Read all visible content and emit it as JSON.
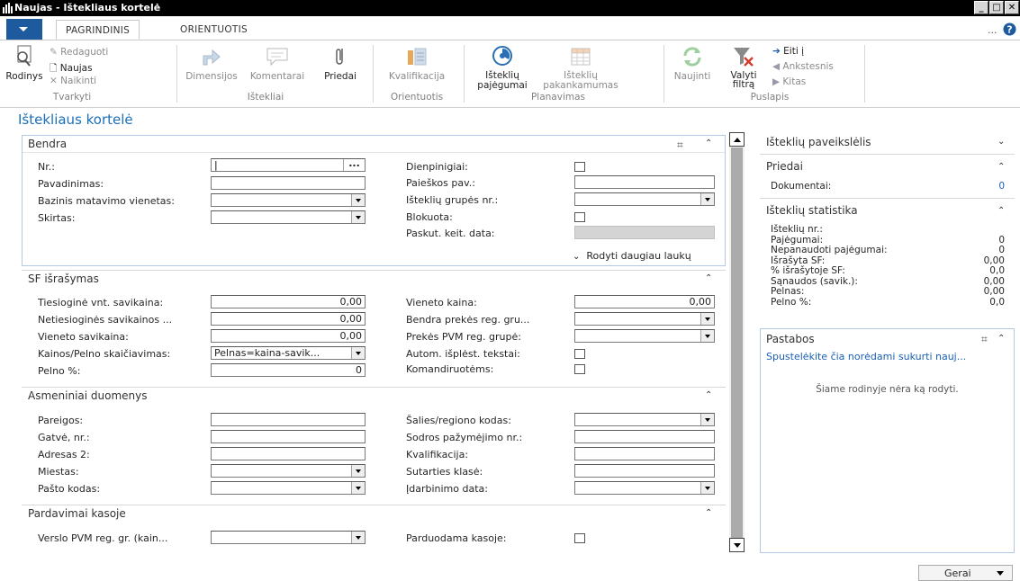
{
  "window": {
    "title": "Naujas - Ištekliaus kortelė"
  },
  "ribbon_tabs": [
    "PAGRINDINIS",
    "ORIENTUOTIS"
  ],
  "ribbon": {
    "tvarkyti": {
      "label": "Tvarkyti",
      "rodinys": "Rodinys",
      "redaguoti": "Redaguoti",
      "naujas": "Naujas",
      "naikinti": "Naikinti"
    },
    "istekliai": {
      "label": "Ištekliai",
      "dimensijos": "Dimensijos",
      "komentarai": "Komentarai",
      "priedai": "Priedai"
    },
    "orientuotis": {
      "label": "Orientuotis",
      "kvalifikacija": "Kvalifikacija"
    },
    "planavimas": {
      "label": "Planavimas",
      "pajegumai_1": "Išteklių",
      "pajegumai_2": "pajėgumai",
      "pakankamumas_1": "Išteklių",
      "pakankamumas_2": "pakankamumas"
    },
    "puslapis": {
      "label": "Puslapis",
      "naujinti": "Naujinti",
      "valyti_1": "Valyti",
      "valyti_2": "filtrą",
      "eiti": "Eiti į",
      "ankstesnis": "Ankstesnis",
      "kitas": "Kitas"
    },
    "more": "..."
  },
  "page_title": "Ištekliaus kortelė",
  "bendra": {
    "title": "Bendra",
    "left": {
      "nr": "Nr.:",
      "pavadinimas": "Pavadinimas:",
      "bazinis": "Bazinis matavimo vienetas:",
      "skirtas": "Skirtas:"
    },
    "right": {
      "dienpinigiai": "Dienpinigiai:",
      "paieskos": "Paieškos pav.:",
      "grupes": "Išteklių grupės nr.:",
      "blokuota": "Blokuota:",
      "paskut": "Paskut. keit. data:"
    },
    "show_more": "Rodyti daugiau laukų",
    "lookup_btn": "..."
  },
  "sf": {
    "title": "SF išrašymas",
    "left": {
      "tiesiogine": "Tiesioginė vnt. savikaina:",
      "tiesiogine_val": "0,00",
      "netiesiogines": "Netiesioginės savikainos ...",
      "netiesiogines_val": "0,00",
      "vieneto_savikaina": "Vieneto savikaina:",
      "vieneto_savikaina_val": "0,00",
      "kainos": "Kainos/Pelno skaičiavimas:",
      "kainos_val": "Pelnas=kaina-savik...",
      "pelno": "Pelno %:",
      "pelno_val": "0"
    },
    "right": {
      "vieneto_kaina": "Vieneto kaina:",
      "vieneto_kaina_val": "0,00",
      "bendra_preke": "Bendra prekės reg. gru...",
      "pvm": "Prekės PVM reg. grupė:",
      "autom": "Autom. išplėst. tekstai:",
      "komand": "Komandiruotėms:"
    }
  },
  "asmeniniai": {
    "title": "Asmeniniai duomenys",
    "left": {
      "pareigos": "Pareigos:",
      "gatve": "Gatvė, nr.:",
      "adresas2": "Adresas 2:",
      "miestas": "Miestas:",
      "pasto": "Pašto kodas:"
    },
    "right": {
      "salies": "Šalies/regiono kodas:",
      "sodros": "Sodros pažymėjimo nr.:",
      "kvalif": "Kvalifikacija:",
      "sutarties": "Sutarties klasė:",
      "idarbinimo": "Įdarbinimo data:"
    }
  },
  "pardavimai": {
    "title": "Pardavimai kasoje",
    "verslo": "Verslo PVM reg. gr. (kain...",
    "parduodama": "Parduodama kasoje:"
  },
  "factbox": {
    "paveikslelis": "Išteklių paveikslėlis",
    "priedai": {
      "title": "Priedai",
      "dokumentai": "Dokumentai:",
      "dokumentai_val": "0"
    },
    "statistika": {
      "title": "Išteklių statistika",
      "rows": [
        {
          "label": "Išteklių nr.:",
          "value": ""
        },
        {
          "label": "Pajėgumai:",
          "value": "0"
        },
        {
          "label": "Nepanaudoti pajėgumai:",
          "value": "0"
        },
        {
          "label": "Išrašyta SF:",
          "value": "0,00"
        },
        {
          "label": "% išrašytoje SF:",
          "value": "0,0"
        },
        {
          "label": "Sąnaudos (savik.):",
          "value": "0,00"
        },
        {
          "label": "Pelnas:",
          "value": "0,00"
        },
        {
          "label": "Pelno %:",
          "value": "0,0"
        }
      ]
    },
    "pastabos": {
      "title": "Pastabos",
      "link": "Spustelėkite čia norėdami sukurti nauj...",
      "empty": "Šiame rodinyje nėra ką rodyti."
    }
  },
  "ok_button": "Gerai",
  "colors": {
    "accent": "#1c6fb8",
    "link": "#1a5fb4",
    "titlebar": "#000000",
    "menu_button": "#1e5a9e"
  }
}
